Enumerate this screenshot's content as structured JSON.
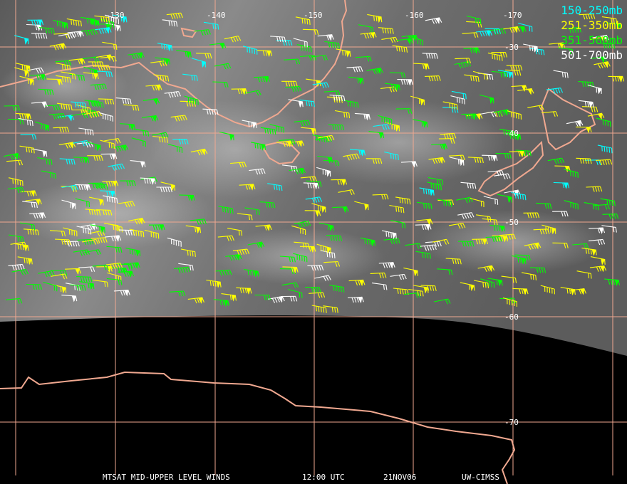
{
  "legend": [
    {
      "label": "150-250mb",
      "color": "#00ffff"
    },
    {
      "label": "251-350mb",
      "color": "#ffff00"
    },
    {
      "label": "351-500mb",
      "color": "#00ff00"
    },
    {
      "label": "501-700mb",
      "color": "#ffffff"
    }
  ],
  "longitude_labels": [
    "-130",
    "-140",
    "-150",
    "-160",
    "-170"
  ],
  "latitude_labels": [
    "-30",
    "-40",
    "-50",
    "-60",
    "-70"
  ],
  "footer": {
    "product": "MTSAT MID-UPPER LEVEL WINDS",
    "time": "12:00 UTC",
    "date": "21NOV06",
    "source": "UW-CIMSS"
  },
  "colors": {
    "grid": "#f0a890",
    "coast": "#f0a890",
    "background": "#000000"
  },
  "icons": [
    "wind-barb-icon"
  ]
}
